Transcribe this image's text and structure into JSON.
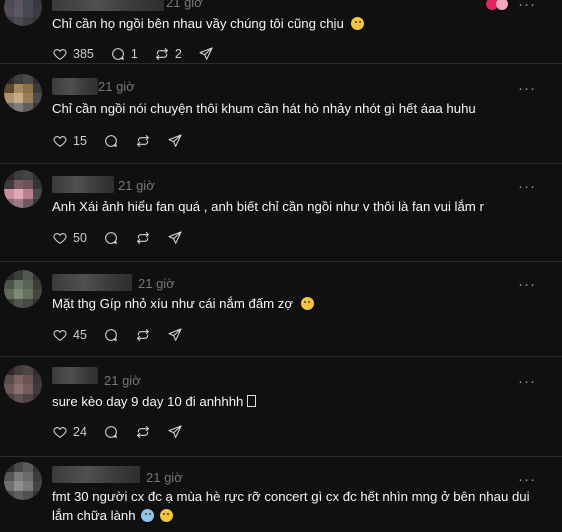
{
  "posts": [
    {
      "time": "21 giờ",
      "text": "Chỉ cần họ ngồi bên nhau vầy chúng tôi cũng chịu",
      "trailing_emoji": "😩",
      "likes": "385",
      "replies": "1",
      "reposts": "2"
    },
    {
      "time": "21 giờ",
      "text": "Chỉ cần ngồi nói chuyện thôi khum cần hát hò nhảy nhót gì hết áaa huhu",
      "likes": "15"
    },
    {
      "time": "21 giờ",
      "text": "Anh Xái ảnh hiểu fan quá , anh biết chỉ cần ngồi như v thôi là fan vui lắm r",
      "likes": "50"
    },
    {
      "time": "21 giờ",
      "text": "Mặt thg Gíp nhỏ xíu như cái nắm đấm zợ",
      "trailing_emoji": "😅",
      "likes": "45"
    },
    {
      "time": "21 giờ",
      "text": "sure kèo day 9 day 10 đi anhhhh",
      "trailing_emoji": "□",
      "likes": "24"
    },
    {
      "time": "21 giờ",
      "text": "fmt 30 người cx đc ạ mùa hè rực rỡ concert gì cx đc hết nhìn mng ở bên nhau dui lắm chữa lành",
      "trailing_emoji": "😭 🥺"
    }
  ],
  "icons": {
    "like": "heart-icon",
    "reply": "comment-icon",
    "repost": "repost-icon",
    "share": "send-icon",
    "more": "more-icon"
  }
}
